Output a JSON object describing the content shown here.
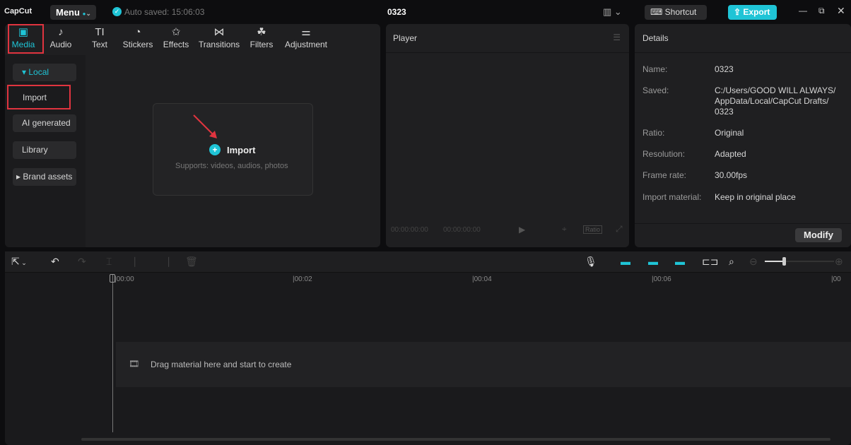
{
  "app": {
    "logo": "CapCut",
    "menu": "Menu",
    "autosave": "Auto saved: 15:06:03",
    "project_title": "0323",
    "shortcut": "Shortcut",
    "export": "Export"
  },
  "tabs": [
    {
      "label": "Media",
      "icon": "media-icon",
      "glyph": "▣"
    },
    {
      "label": "Audio",
      "icon": "audio-icon",
      "glyph": "♪"
    },
    {
      "label": "Text",
      "icon": "text-icon",
      "glyph": "TI"
    },
    {
      "label": "Stickers",
      "icon": "sticker-icon",
      "glyph": "◔"
    },
    {
      "label": "Effects",
      "icon": "effects-icon",
      "glyph": "✩"
    },
    {
      "label": "Transitions",
      "icon": "transitions-icon",
      "glyph": "⋈"
    },
    {
      "label": "Filters",
      "icon": "filters-icon",
      "glyph": "☘"
    },
    {
      "label": "Adjustment",
      "icon": "adjustment-icon",
      "glyph": "⚌"
    }
  ],
  "sidebar": {
    "local": "Local",
    "import": "Import",
    "ai": "AI generated",
    "library": "Library",
    "brand": "Brand assets"
  },
  "import_box": {
    "label": "Import",
    "sub": "Supports: videos, audios, photos"
  },
  "player": {
    "title": "Player",
    "time_current": "00:00:00:00",
    "time_total": "00:00:00:00",
    "ratio": "Ratio"
  },
  "details": {
    "title": "Details",
    "rows": [
      {
        "label": "Name:",
        "value": "0323"
      },
      {
        "label": "Saved:",
        "value": "C:/Users/GOOD WILL ALWAYS/ AppData/Local/CapCut Drafts/ 0323"
      },
      {
        "label": "Ratio:",
        "value": "Original"
      },
      {
        "label": "Resolution:",
        "value": "Adapted"
      },
      {
        "label": "Frame rate:",
        "value": "30.00fps"
      },
      {
        "label": "Import material:",
        "value": "Keep in original place"
      }
    ],
    "modify": "Modify"
  },
  "timeline": {
    "ticks": [
      "00:00",
      "00:02",
      "00:04",
      "00:06",
      "00"
    ],
    "drop_hint": "Drag material here and start to create"
  },
  "colors": {
    "accent": "#1fc4d6",
    "highlight": "#e0343f"
  }
}
